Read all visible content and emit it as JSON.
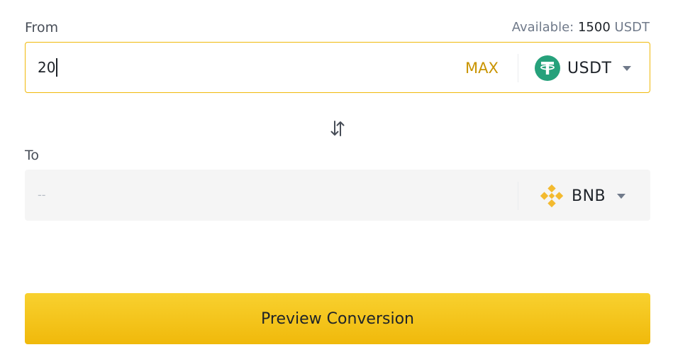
{
  "from": {
    "label": "From",
    "available_label": "Available:",
    "available_amount": "1500",
    "available_unit": "USDT",
    "amount_value": "20",
    "max_label": "MAX",
    "coin": {
      "name": "USDT",
      "icon": "tether-icon",
      "icon_color": "#26a17b"
    }
  },
  "swap": {
    "icon": "swap-arrows-icon"
  },
  "to": {
    "label": "To",
    "amount_placeholder": "--",
    "coin": {
      "name": "BNB",
      "icon": "bnb-icon",
      "icon_color": "#f3ba2f"
    }
  },
  "actions": {
    "preview_label": "Preview Conversion"
  },
  "colors": {
    "accent": "#f0b90b",
    "max_text": "#c99400",
    "muted": "#707a8a"
  }
}
